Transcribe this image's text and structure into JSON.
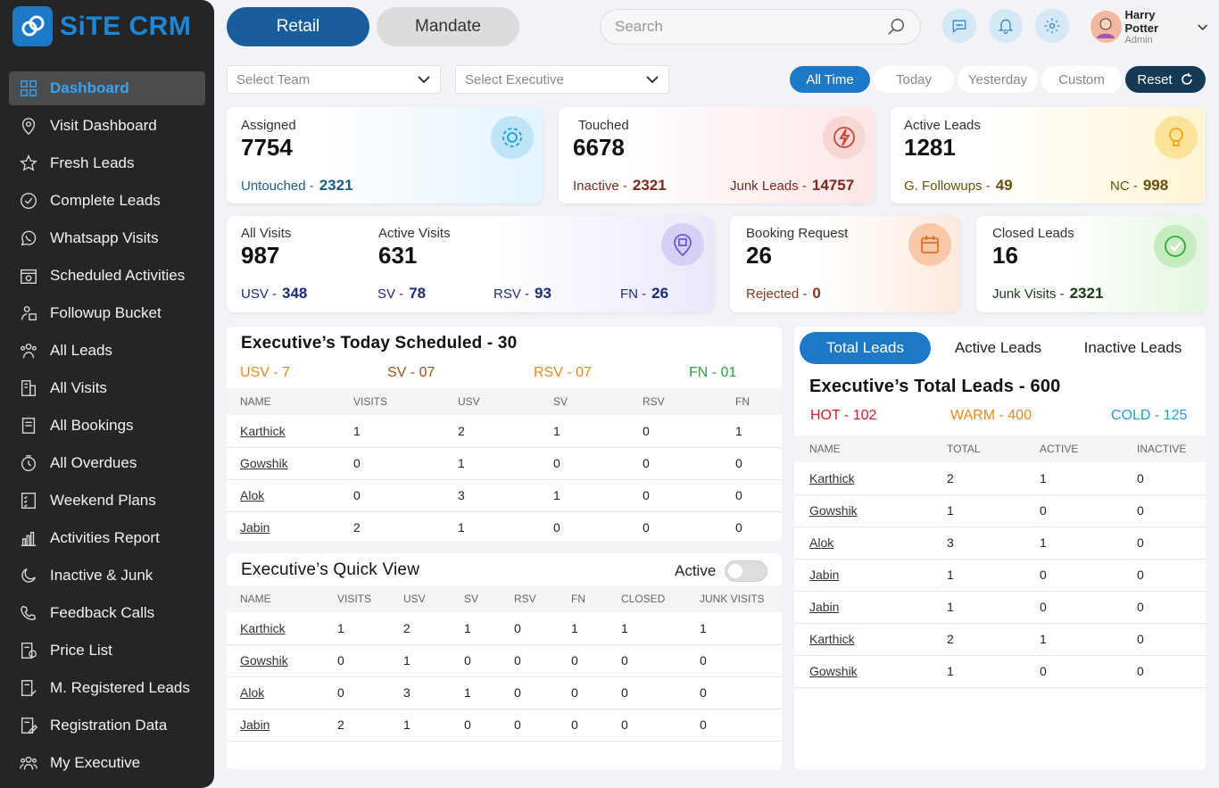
{
  "brand": {
    "name": "SiTE CRM"
  },
  "sidebar": {
    "items": [
      {
        "label": "Dashboard",
        "icon": "dashboard-icon"
      },
      {
        "label": "Visit Dashboard",
        "icon": "location-pin-icon"
      },
      {
        "label": "Fresh Leads",
        "icon": "star-icon"
      },
      {
        "label": "Complete Leads",
        "icon": "check-circle-icon"
      },
      {
        "label": "Whatsapp Visits",
        "icon": "whatsapp-icon"
      },
      {
        "label": "Scheduled Activities",
        "icon": "calendar-icon"
      },
      {
        "label": "Followup Bucket",
        "icon": "bucket-icon"
      },
      {
        "label": "All Leads",
        "icon": "users-icon"
      },
      {
        "label": "All Visits",
        "icon": "building-icon"
      },
      {
        "label": "All Bookings",
        "icon": "book-icon"
      },
      {
        "label": "All Overdues",
        "icon": "clock-icon"
      },
      {
        "label": "Weekend Plans",
        "icon": "checklist-icon"
      },
      {
        "label": "Activities Report",
        "icon": "bar-chart-icon"
      },
      {
        "label": "Inactive & Junk",
        "icon": "moon-icon"
      },
      {
        "label": "Feedback Calls",
        "icon": "phone-icon"
      },
      {
        "label": "Price List",
        "icon": "price-list-icon"
      },
      {
        "label": "M. Registered Leads",
        "icon": "register-icon"
      },
      {
        "label": "Registration Data",
        "icon": "edit-doc-icon"
      },
      {
        "label": "My Executive",
        "icon": "team-icon"
      }
    ]
  },
  "topbar": {
    "retail": "Retail",
    "mandate": "Mandate",
    "search_placeholder": "Search",
    "user_name": "Harry Potter",
    "user_role": "Admin"
  },
  "filters": {
    "team": "Select Team",
    "executive": "Select Executive",
    "times": [
      "All Time",
      "Today",
      "Yesterday",
      "Custom"
    ],
    "reset": "Reset"
  },
  "cards": {
    "assigned": {
      "label": "Assigned",
      "value": "7754",
      "sub_label": "Untouched -",
      "sub_value": "2321"
    },
    "touched": {
      "label": "Touched",
      "value": "6678",
      "sub1_label": "Inactive -",
      "sub1_value": "2321",
      "sub2_label": "Junk Leads -",
      "sub2_value": "14757"
    },
    "active_leads": {
      "label": "Active Leads",
      "value": "1281",
      "sub1_label": "G. Followups -",
      "sub1_value": "49",
      "sub2_label": "NC -",
      "sub2_value": "998"
    },
    "visits": {
      "all_label": "All Visits",
      "all_value": "987",
      "active_label": "Active Visits",
      "active_value": "631",
      "usv_label": "USV -",
      "usv_value": "348",
      "sv_label": "SV -",
      "sv_value": "78",
      "rsv_label": "RSV -",
      "rsv_value": "93",
      "fn_label": "FN -",
      "fn_value": "26"
    },
    "booking": {
      "label": "Booking Request",
      "value": "26",
      "sub_label": "Rejected -",
      "sub_value": "0"
    },
    "closed": {
      "label": "Closed Leads",
      "value": "16",
      "sub_label": "Junk Visits -",
      "sub_value": "2321"
    }
  },
  "colors": {
    "primary": "#1e78c8",
    "dark": "#143a56",
    "usv": "#e8891c",
    "sv": "#a0521d",
    "rsv": "#e8891c",
    "fn": "#2ba33a",
    "hot": "#c8232c",
    "warm": "#e8891c",
    "cold": "#1e9fd6"
  },
  "today_scheduled": {
    "title": "Executive’s Today Scheduled - 30",
    "stats": [
      "USV - 7",
      "SV - 07",
      "RSV - 07",
      "FN - 01"
    ],
    "headers": [
      "NAME",
      "VISITS",
      "USV",
      "SV",
      "RSV",
      "FN"
    ],
    "rows": [
      [
        "Karthick",
        "1",
        "2",
        "1",
        "0",
        "1"
      ],
      [
        "Gowshik",
        "0",
        "1",
        "0",
        "0",
        "0"
      ],
      [
        "Alok",
        "0",
        "3",
        "1",
        "0",
        "0"
      ],
      [
        "Jabin",
        "2",
        "1",
        "0",
        "0",
        "0"
      ]
    ]
  },
  "quick_view": {
    "title": "Executive’s Quick View",
    "toggle_label": "Active",
    "headers": [
      "NAME",
      "VISITS",
      "USV",
      "SV",
      "RSV",
      "FN",
      "CLOSED",
      "JUNK VISITS"
    ],
    "rows": [
      [
        "Karthick",
        "1",
        "2",
        "1",
        "0",
        "1",
        "1",
        "1"
      ],
      [
        "Gowshik",
        "0",
        "1",
        "0",
        "0",
        "0",
        "0",
        "0"
      ],
      [
        "Alok",
        "0",
        "3",
        "1",
        "0",
        "0",
        "0",
        "0"
      ],
      [
        "Jabin",
        "2",
        "1",
        "0",
        "0",
        "0",
        "0",
        "0"
      ]
    ]
  },
  "total_leads": {
    "tabs": [
      "Total Leads",
      "Active Leads",
      "Inactive Leads"
    ],
    "title": "Executive’s Total Leads - 600",
    "stats": [
      "HOT - 102",
      "WARM - 400",
      "COLD - 125"
    ],
    "headers": [
      "NAME",
      "TOTAL",
      "ACTIVE",
      "INACTIVE"
    ],
    "rows": [
      [
        "Karthick",
        "2",
        "1",
        "0"
      ],
      [
        "Gowshik",
        "1",
        "0",
        "0"
      ],
      [
        "Alok",
        "3",
        "1",
        "0"
      ],
      [
        "Jabin",
        "1",
        "0",
        "0"
      ],
      [
        "Jabin",
        "1",
        "0",
        "0"
      ],
      [
        "Karthick",
        "2",
        "1",
        "0"
      ],
      [
        "Gowshik",
        "1",
        "0",
        "0"
      ]
    ]
  }
}
